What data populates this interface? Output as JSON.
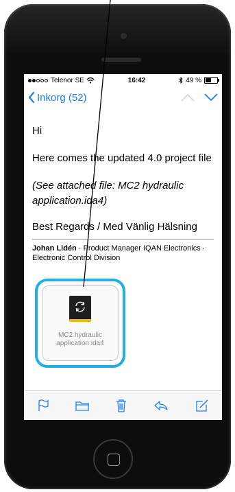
{
  "status": {
    "carrier": "Telenor SE",
    "time": "16:42",
    "battery": "49 %"
  },
  "nav": {
    "back_label": "Inkorg (52)"
  },
  "email": {
    "greeting": "Hi",
    "line1": "Here comes the updated 4.0 project file",
    "line2": "(See attached file: MC2 hydraulic application.ida4)",
    "line3": "Best Regards / Med Vänlig Hälsning",
    "sig_name": "Johan Lidén",
    "sig_rest": "· Product Manager IQAN Electronics · Electronic Control Division"
  },
  "attachment": {
    "name_line1": "MC2 hydraulic",
    "name_line2": "application.ida4"
  },
  "toolbar": [
    "flag-icon",
    "folder-icon",
    "trash-icon",
    "reply-icon",
    "compose-icon"
  ],
  "colors": {
    "accent": "#1a7dfb",
    "highlight": "#22aee6"
  }
}
